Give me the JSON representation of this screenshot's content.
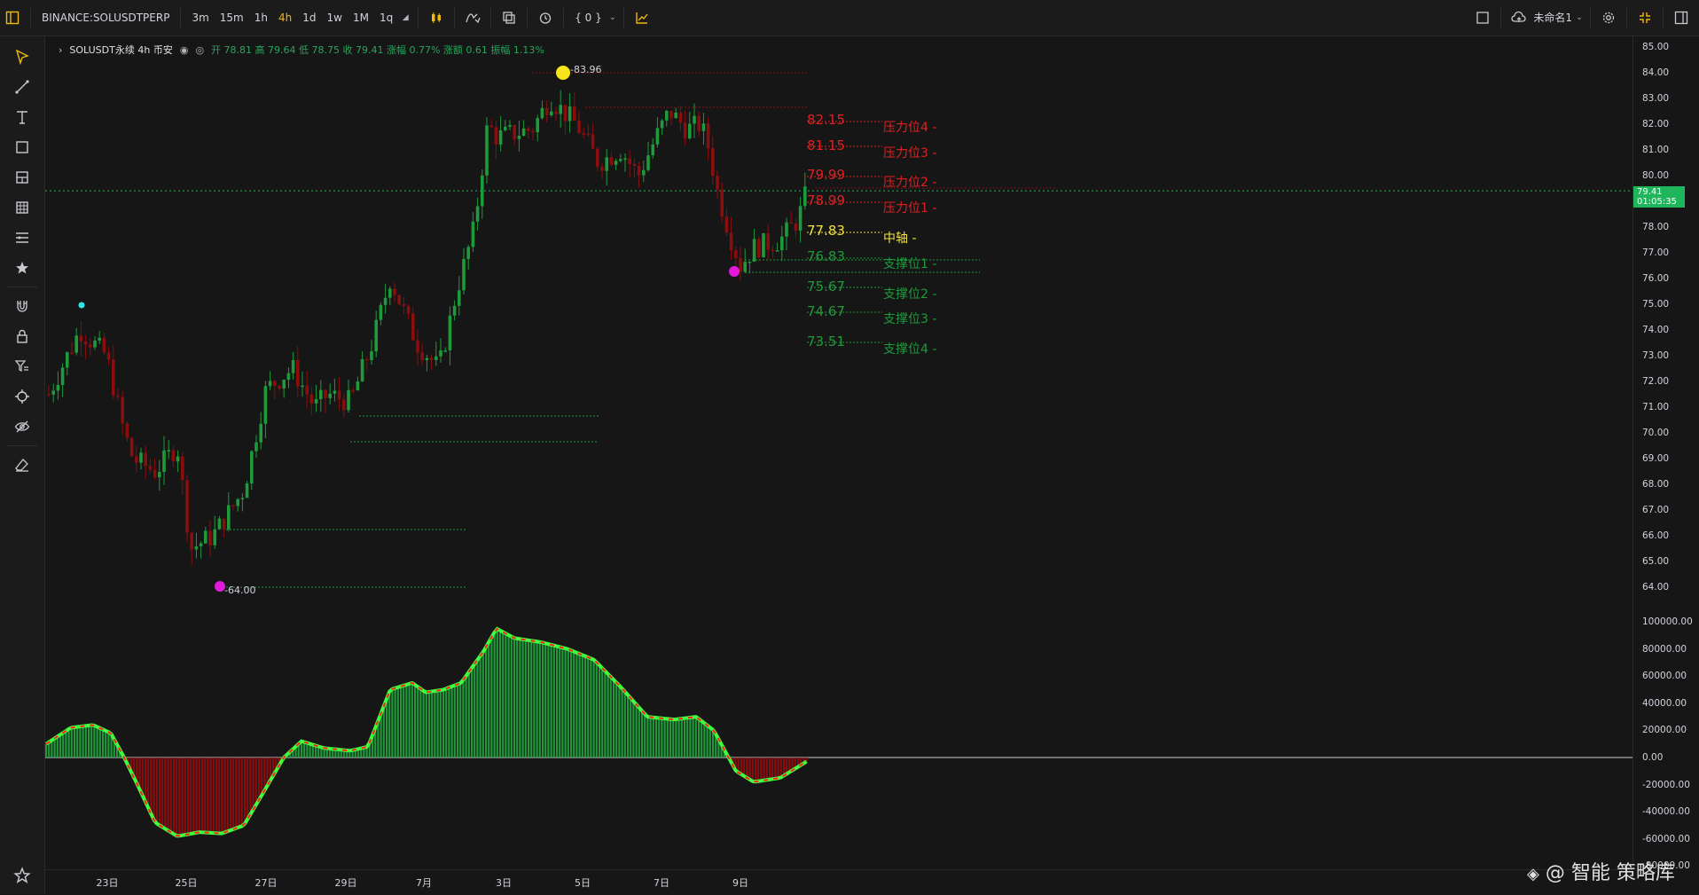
{
  "toolbar": {
    "symbol": "BINANCE:SOLUSDTPERP",
    "intervals": [
      "3m",
      "15m",
      "1h",
      "4h",
      "1d",
      "1w",
      "1M",
      "1q"
    ],
    "active_interval": "4h",
    "script_label": "{ 0 }",
    "layout_name": "未命名1"
  },
  "legend": {
    "title": "SOLUSDT永续 4h 币安",
    "values": "开 78.81 高 79.64 低 78.75 收 79.41 涨幅 0.77% 涨额 0.61 振幅 1.13%"
  },
  "price_axis": [
    "85.00",
    "84.00",
    "83.00",
    "82.00",
    "81.00",
    "80.00",
    "79.00",
    "78.00",
    "77.00",
    "76.00",
    "75.00",
    "74.00",
    "73.00",
    "72.00",
    "71.00",
    "70.00",
    "69.00",
    "68.00",
    "67.00",
    "66.00",
    "65.00",
    "64.00"
  ],
  "indicator_axis": [
    "100000.00",
    "80000.00",
    "60000.00",
    "40000.00",
    "20000.00",
    "0.00",
    "-20000.00",
    "-40000.00",
    "-60000.00",
    "-80000.00"
  ],
  "time_axis": [
    "23日",
    "25日",
    "27日",
    "29日",
    "7月",
    "3日",
    "5日",
    "7日",
    "9日"
  ],
  "last_price": {
    "price": "79.41",
    "countdown": "01:05:35"
  },
  "markers": {
    "high": "83.96",
    "low": "64.00"
  },
  "levels": [
    {
      "value": "82.15",
      "name": "压力位4 -",
      "color": "#e02020"
    },
    {
      "value": "81.15",
      "name": "压力位3 -",
      "color": "#e02020"
    },
    {
      "value": "79.99",
      "name": "压力位2 -",
      "color": "#e02020"
    },
    {
      "value": "78.99",
      "name": "压力位1 -",
      "color": "#e02020"
    },
    {
      "value": "77.83",
      "name": "中轴 -",
      "color": "#f0e040"
    },
    {
      "value": "76.83",
      "name": "支撑位1 -",
      "color": "#1f9a3a"
    },
    {
      "value": "75.67",
      "name": "支撑位2 -",
      "color": "#1f9a3a"
    },
    {
      "value": "74.67",
      "name": "支撑位3 -",
      "color": "#1f9a3a"
    },
    {
      "value": "73.51",
      "name": "支撑位4 -",
      "color": "#1f9a3a"
    }
  ],
  "watermark": "@ 智能 策略库",
  "colors": {
    "up": "#1f9a3a",
    "down": "#8b0e0e",
    "accent": "#f0b90b"
  }
}
